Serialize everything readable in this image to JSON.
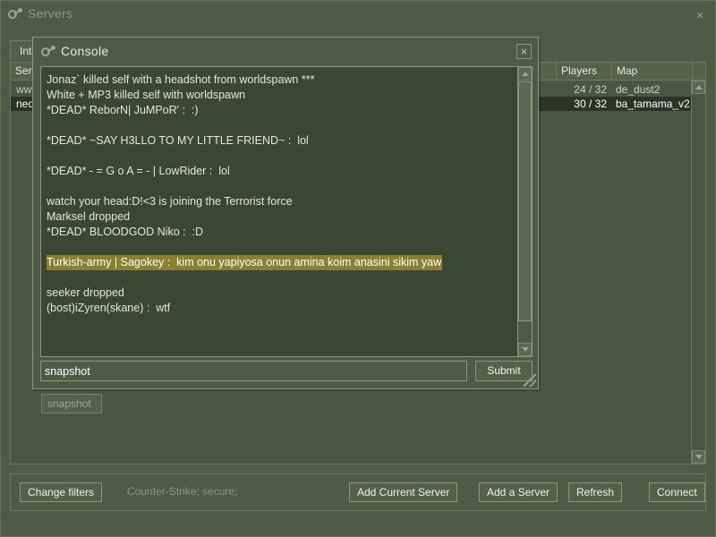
{
  "main_window": {
    "title": "Servers",
    "icon": "valve-steam-icon",
    "close_label": "×",
    "tabs": [
      {
        "label": "Internet",
        "selected": true
      }
    ],
    "server_list": {
      "columns": [
        {
          "key": "servers",
          "label": "Servers"
        },
        {
          "key": "players",
          "label": "Players"
        },
        {
          "key": "map",
          "label": "Map"
        }
      ],
      "rows": [
        {
          "servers": "www",
          "players": "24 / 32",
          "map": "de_dust2",
          "selected": false
        },
        {
          "servers": "neonl",
          "players": "30 / 32",
          "map": "ba_tamama_v2",
          "selected": true
        }
      ]
    },
    "bottom_bar": {
      "change_filters_label": "Change filters",
      "filter_description": "Counter-Strike; secure;",
      "add_current_server_label": "Add Current Server",
      "add_a_server_label": "Add a Server",
      "refresh_label": "Refresh",
      "connect_label": "Connect"
    }
  },
  "console_window": {
    "title": "Console",
    "icon": "valve-steam-icon",
    "close_label": "×",
    "log_lines": [
      {
        "text": "Jonaz` killed self with a headshot from worldspawn ***",
        "selected": false
      },
      {
        "text": "White + MP3 killed self with worldspawn",
        "selected": false
      },
      {
        "text": "*DEAD* ReborN| JuMPoR' :  :)",
        "selected": false
      },
      {
        "text": "",
        "selected": false
      },
      {
        "text": "*DEAD* ~SAY H3LLO TO MY LITTLE FRIEND~ :  lol",
        "selected": false
      },
      {
        "text": "",
        "selected": false
      },
      {
        "text": "*DEAD* - = G o A = - | LowRider :  lol",
        "selected": false
      },
      {
        "text": "",
        "selected": false
      },
      {
        "text": "watch your head:D!<3 is joining the Terrorist force",
        "selected": false
      },
      {
        "text": "Marksel dropped",
        "selected": false
      },
      {
        "text": "*DEAD* BLOODGOD Niko :  :D",
        "selected": false
      },
      {
        "text": "",
        "selected": false
      },
      {
        "text": "Turkish-army | Sagokey :  kim onu yapiyosa onun amina koim anasini sikim yaw",
        "selected": true
      },
      {
        "text": "",
        "selected": false
      },
      {
        "text": "seeker dropped",
        "selected": false
      },
      {
        "text": "(bost)iZyren(skane) :  wtf",
        "selected": false
      }
    ],
    "input_value": "snapshot",
    "input_placeholder": "",
    "submit_label": "Submit"
  },
  "autocomplete": {
    "items": [
      {
        "label": "snapshot"
      }
    ]
  },
  "colors": {
    "window_bg": "#4e5b45",
    "log_bg": "#3b4635",
    "selection_highlight": "#8a8030",
    "border": "#8b9781",
    "text": "#e2e8da",
    "dim_text": "#8a9680"
  }
}
